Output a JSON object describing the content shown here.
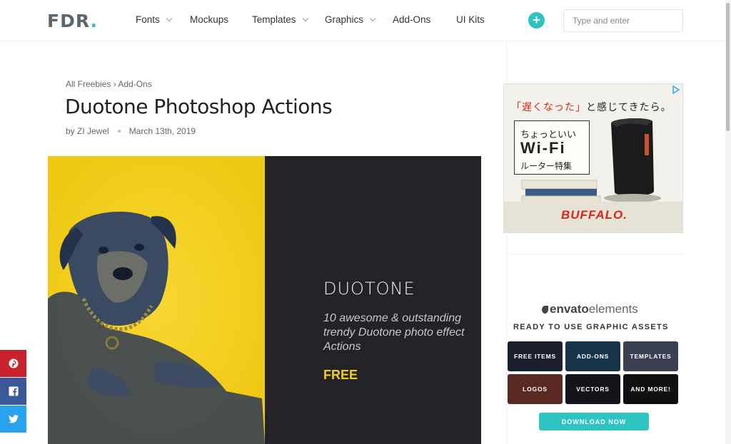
{
  "header": {
    "logo_text": "FDR",
    "logo_dot": ".",
    "nav": [
      {
        "label": "Fonts",
        "has_dropdown": true
      },
      {
        "label": "Mockups",
        "has_dropdown": false
      },
      {
        "label": "Templates",
        "has_dropdown": true
      },
      {
        "label": "Graphics",
        "has_dropdown": true
      },
      {
        "label": "Add-Ons",
        "has_dropdown": false
      },
      {
        "label": "UI Kits",
        "has_dropdown": false
      }
    ],
    "plus_label": "+",
    "search_placeholder": "Type and enter"
  },
  "article": {
    "breadcrumb": "All Freebies › Add-Ons",
    "title": "Duotone Photoshop Actions",
    "author": "by ZI Jewel",
    "date": "March 13th, 2019",
    "hero": {
      "title": "DUOTONE",
      "description": "10 awesome & outstanding trendy Duotone photo effect Actions",
      "price_tag": "FREE"
    }
  },
  "share": [
    {
      "network": "pinterest",
      "icon": "pinterest-icon"
    },
    {
      "network": "facebook",
      "icon": "facebook-icon"
    },
    {
      "network": "twitter",
      "icon": "twitter-icon"
    }
  ],
  "ad_buffalo": {
    "top_red": "「遅くなった」",
    "top_rest": "と感じてきたら。",
    "line1": "ちょっといい",
    "line2": "Wi-Fi",
    "line3": "ルーター特集",
    "brand": "BUFFALO."
  },
  "ad_envato": {
    "logo_main": "envato",
    "logo_sub": "elements",
    "tagline": "READY TO USE GRAPHIC ASSETS",
    "tiles": [
      "FREE ITEMS",
      "ADD-ONS",
      "TEMPLATES",
      "LOGOS",
      "VECTORS",
      "AND MORE!"
    ],
    "cta": "DOWNLOAD NOW"
  },
  "colors": {
    "accent": "#2bc4c0",
    "hero_yellow": "#f2cd1e",
    "hero_dark": "#232327",
    "pinterest": "#c8232c",
    "facebook": "#3b5998",
    "twitter": "#2aa3ef"
  }
}
